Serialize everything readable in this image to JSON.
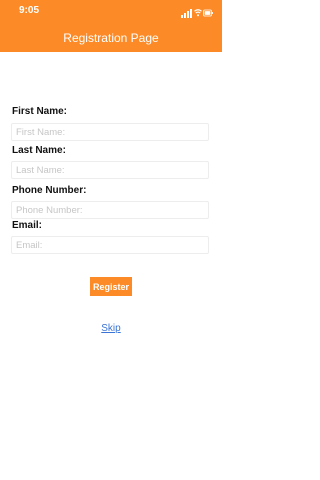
{
  "status_bar": {
    "time": "9:05",
    "icons": [
      "signal-icon",
      "wifi-icon",
      "battery-icon"
    ]
  },
  "header": {
    "title": "Registration Page"
  },
  "form": {
    "first_name": {
      "label": "First Name:",
      "placeholder": "First Name:",
      "value": ""
    },
    "last_name": {
      "label": "Last Name:",
      "placeholder": "Last Name:",
      "value": ""
    },
    "phone_number": {
      "label": "Phone Number:",
      "placeholder": "Phone Number:",
      "value": ""
    },
    "email": {
      "label": "Email:",
      "placeholder": "Email:",
      "value": ""
    }
  },
  "actions": {
    "register_label": "Register",
    "skip_label": "Skip"
  },
  "colors": {
    "accent": "#fc8b27",
    "link": "#3a74d6",
    "field_border": "#ededed"
  }
}
